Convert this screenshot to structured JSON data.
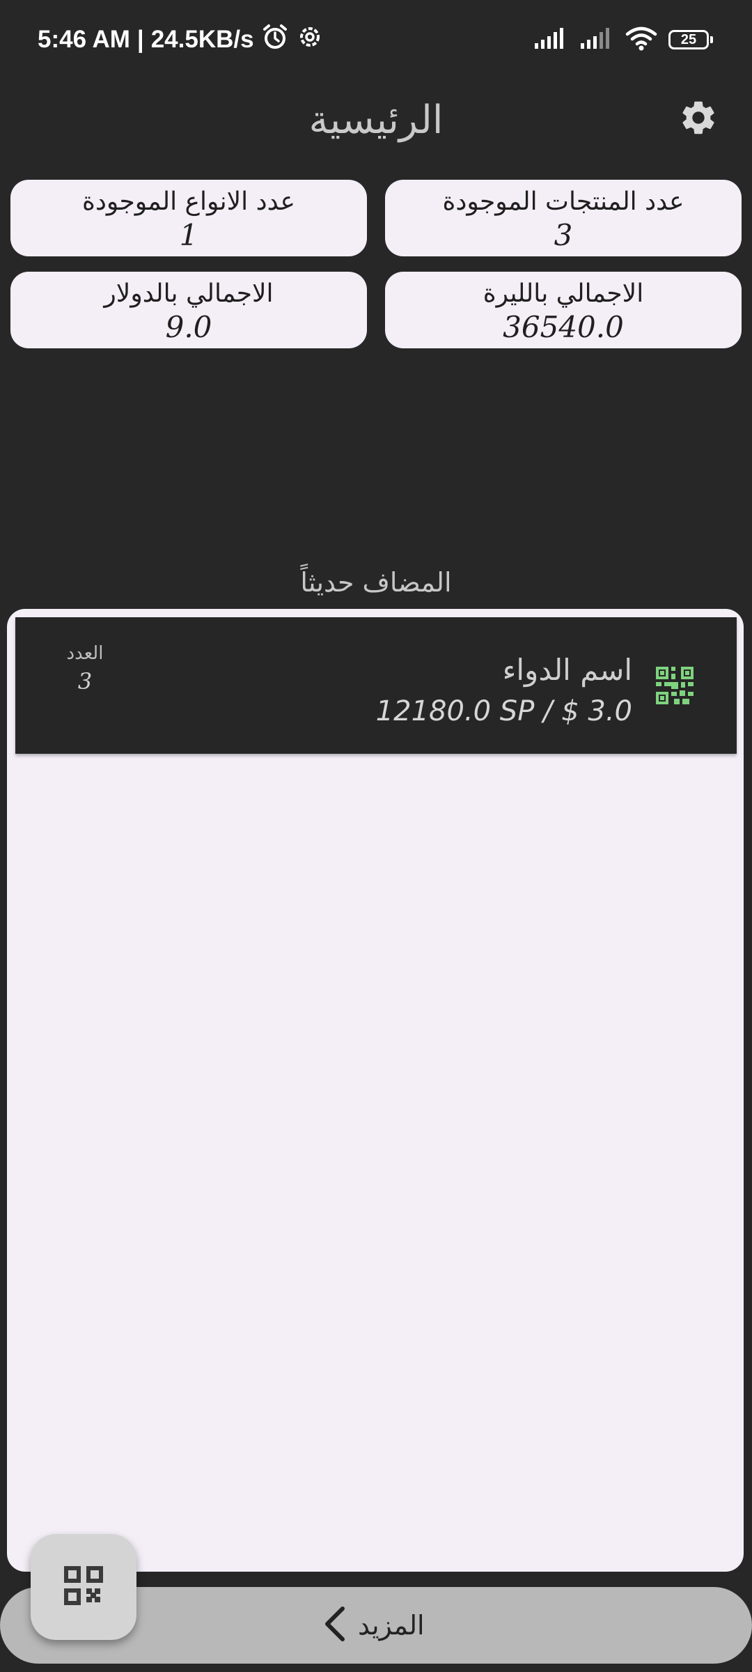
{
  "status_bar": {
    "time": "5:46 AM",
    "network_speed": "24.5KB/s",
    "battery": "25",
    "icons": [
      "alarm-icon",
      "settings-gear-icon",
      "signal-icon",
      "signal-icon",
      "wifi-icon",
      "battery-icon"
    ]
  },
  "header": {
    "title": "الرئيسية",
    "settings_icon": "settings-icon"
  },
  "stats": [
    {
      "label": "عدد المنتجات الموجودة",
      "value": "3"
    },
    {
      "label": "عدد الانواع الموجودة",
      "value": "1"
    },
    {
      "label": "الاجمالي بالليرة",
      "value": "36540.0"
    },
    {
      "label": "الاجمالي بالدولار",
      "value": "9.0"
    }
  ],
  "recent": {
    "title": "المضاف حديثاً",
    "items": [
      {
        "name": "اسم الدواء",
        "price": "12180.0 SP / $ 3.0",
        "count_label": "العدد",
        "count": "3",
        "icon": "qr-code-icon",
        "icon_color": "#7ed37e"
      }
    ]
  },
  "bottom_bar": {
    "more_label": "المزيد",
    "more_icon": "chevron-left-icon"
  },
  "fab": {
    "icon": "qr-scan-icon"
  },
  "colors": {
    "background": "#272727",
    "card": "#f4eff7",
    "accent_green": "#7ed37e",
    "bottom_bar": "#b8b8b8"
  }
}
